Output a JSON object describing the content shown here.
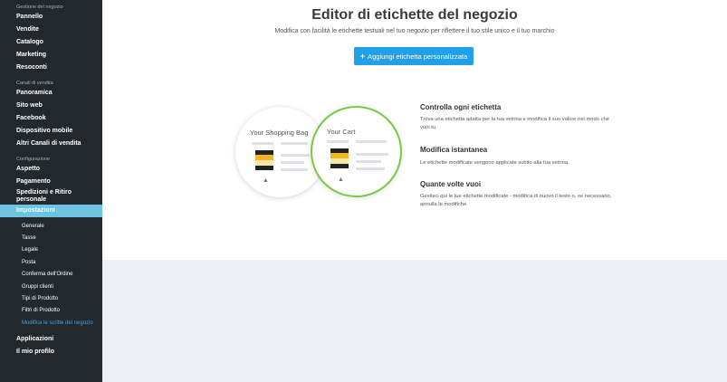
{
  "sidebar": {
    "section1": "Gestione del negozio",
    "items1": [
      "Pannello",
      "Vendite",
      "Catalogo",
      "Marketing",
      "Resoconti"
    ],
    "section2": "Canali di vendita",
    "items2": [
      "Panoramica",
      "Sito web",
      "Facebook",
      "Dispositivo mobile",
      "Altri Canali di vendita"
    ],
    "section3": "Configurazione",
    "items3": [
      "Aspetto",
      "Pagamento",
      "Spedizioni e Ritiro personale"
    ],
    "active": "Impostazioni",
    "sub": [
      "Generale",
      "Tasse",
      "Legale",
      "Posta",
      "Conferma dell'Ordine",
      "Gruppi clienti",
      "Tipi di Prodotto",
      "Filtri di Prodotto",
      "Modifica le scritte del negozio"
    ],
    "bottom": [
      "Applicazioni",
      "Il mio profilo"
    ]
  },
  "main": {
    "title": "Editor di etichette del negozio",
    "subtitle": "Modifica con facilità le etichette testuali nel tuo negozio per riflettere il tuo stile unico e il tuo marchio",
    "add_button": "Aggiungi etichetta personalizzata",
    "illustration": {
      "left_label": "Your Shopping Bag",
      "right_label": "Your Cart"
    },
    "features": [
      {
        "heading": "Controlla ogni etichetta",
        "text": "Trova una etichetta adatta per la tua vetrina e modifica il suo valore nel modo che vuoi tu."
      },
      {
        "heading": "Modifica istantanea",
        "text": "Le etichette modificate vengono applicate subito alla tua vetrina."
      },
      {
        "heading": "Quante volte vuoi",
        "text": "Gestisci qui le tue etichette modificate - modifica di nuovo il testo o, se necessario, annulla le modifiche."
      }
    ]
  },
  "colors": {
    "sidebar_bg": "#23282d",
    "active_bg": "#6ec3e3",
    "accent": "#1fa0e8",
    "green": "#7ac943"
  }
}
